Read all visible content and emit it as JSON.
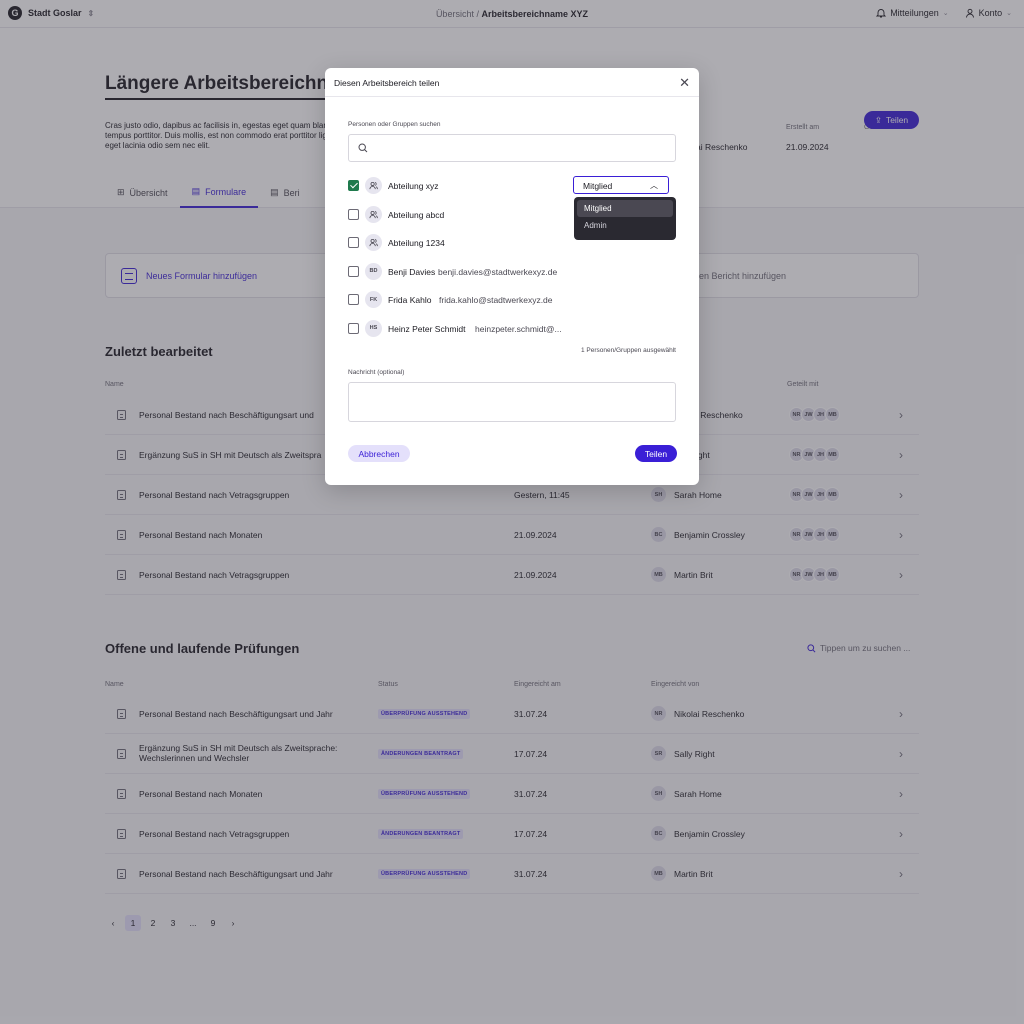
{
  "topbar": {
    "org": "Stadt Goslar",
    "logo_letter": "G",
    "crumb_root": "Übersicht",
    "crumb_sep": "/",
    "crumb_current": "Arbeitsbereichname XYZ",
    "notifications": "Mitteilungen",
    "account": "Konto"
  },
  "header": {
    "title": "Längere Arbeitsbereichname",
    "description": "Cras justo odio, dapibus ac facilisis in, egestas eget quam blandit tempus porttitor. Duis mollis, est non commodo erat porttitor ligula, eget lacinia odio sem nec elit.",
    "owner_partial": "ai Reschenko",
    "created_label": "Erstellt am",
    "created_value": "21.09.2024",
    "shared_label": "Geteilt mit",
    "share_button": "Teilen"
  },
  "tabs": [
    {
      "label": "Übersicht"
    },
    {
      "label": "Formulare"
    },
    {
      "label": "Beri"
    }
  ],
  "add_cards": {
    "form": "Neues Formular hinzufügen",
    "report_partial": "uen Bericht hinzufügen"
  },
  "recent": {
    "title": "Zuletzt bearbeitet",
    "col_name": "Name",
    "col_shared": "Geteilt mit",
    "rows": [
      {
        "name": "Personal Bestand nach Beschäftigungsart und",
        "date": "",
        "user_initials": "",
        "user": "i Reschenko"
      },
      {
        "name": "Ergänzung SuS in SH mit Deutsch als Zweitspra",
        "date": "",
        "user_initials": "",
        "user": "ight"
      },
      {
        "name": "Personal Bestand nach Vetragsgruppen",
        "date": "Gestern, 11:45",
        "user_initials": "SH",
        "user": "Sarah Home"
      },
      {
        "name": "Personal Bestand nach Monaten",
        "date": "21.09.2024",
        "user_initials": "BC",
        "user": "Benjamin Crossley"
      },
      {
        "name": "Personal Bestand nach Vetragsgruppen",
        "date": "21.09.2024",
        "user_initials": "MB",
        "user": "Martin Brit"
      }
    ],
    "shared_avatars": [
      "NR",
      "JW",
      "JH",
      "MB"
    ]
  },
  "reviews": {
    "title": "Offene und laufende Prüfungen",
    "search_placeholder": "Tippen um zu suchen ...",
    "col_name": "Name",
    "col_status": "Status",
    "col_submitted": "Eingereicht am",
    "col_by": "Eingereicht von",
    "rows": [
      {
        "name": "Personal Bestand nach Beschäftigungsart und Jahr",
        "status": "ÜBERPRÜFUNG AUSSTEHEND",
        "date": "31.07.24",
        "initials": "NR",
        "user": "Nikolai Reschenko"
      },
      {
        "name": "Ergänzung SuS in SH mit Deutsch als Zweitsprache: Wechslerinnen und Wechsler",
        "status": "ÄNDERUNGEN BEANTRAGT",
        "date": "17.07.24",
        "initials": "SR",
        "user": "Sally Right"
      },
      {
        "name": "Personal Bestand nach Monaten",
        "status": "ÜBERPRÜFUNG AUSSTEHEND",
        "date": "31.07.24",
        "initials": "SH",
        "user": "Sarah Home"
      },
      {
        "name": "Personal Bestand nach Vetragsgruppen",
        "status": "ÄNDERUNGEN BEANTRAGT",
        "date": "17.07.24",
        "initials": "BC",
        "user": "Benjamin Crossley"
      },
      {
        "name": "Personal Bestand nach Beschäftigungsart und Jahr",
        "status": "ÜBERPRÜFUNG AUSSTEHEND",
        "date": "31.07.24",
        "initials": "MB",
        "user": "Martin Brit"
      }
    ]
  },
  "pager": {
    "prev": "‹",
    "pages": [
      "1",
      "2",
      "3",
      "...",
      "9"
    ],
    "next": "›"
  },
  "modal": {
    "title": "Diesen Arbeitsbereich teilen",
    "search_label": "Personen oder Gruppen suchen",
    "search_value": "",
    "people": [
      {
        "name": "Abteilung xyz",
        "email": "",
        "initials": "",
        "checked": true
      },
      {
        "name": "Abteilung abcd",
        "email": "",
        "initials": "",
        "checked": false
      },
      {
        "name": "Abteilung 1234",
        "email": "",
        "initials": "",
        "checked": false
      },
      {
        "name": "Benji Davies",
        "email": "benji.davies@stadtwerkexyz.de",
        "initials": "BD",
        "checked": false
      },
      {
        "name": "Frida Kahlo",
        "email": "frida.kahlo@stadtwerkexyz.de",
        "initials": "FK",
        "checked": false
      },
      {
        "name": "Heinz Peter Schmidt",
        "email": "heinzpeter.schmidt@...",
        "initials": "HS",
        "checked": false
      }
    ],
    "role_selected": "Mitglied",
    "role_options": [
      "Mitglied",
      "Admin"
    ],
    "selected_count": "1 Personen/Gruppen ausgewählt",
    "message_label": "Nachricht (optional)",
    "message_value": "",
    "cancel": "Abbrechen",
    "share": "Teilen"
  },
  "colors": {
    "accent": "#3a1fd6",
    "check": "#1f7a4d",
    "badge_bg": "#e4e0fb"
  }
}
